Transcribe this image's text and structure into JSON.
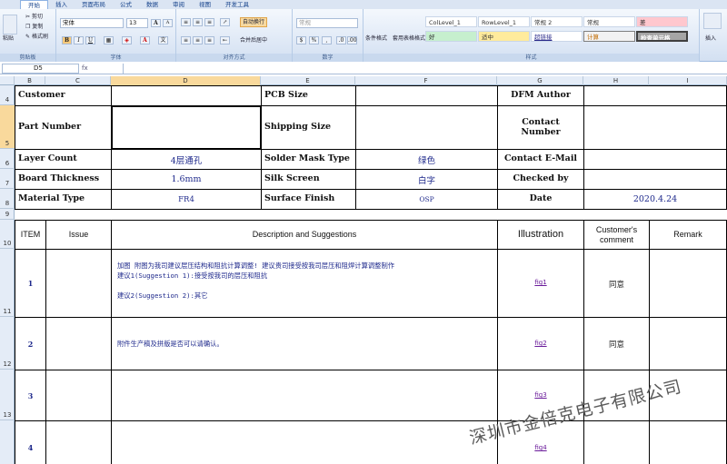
{
  "ribbon": {
    "tabs": [
      "开始",
      "插入",
      "页面布局",
      "公式",
      "数据",
      "审阅",
      "视图",
      "开发工具"
    ],
    "clipboard": {
      "paste": "粘贴",
      "cut": "剪切",
      "copy": "复制",
      "format_painter": "格式刷",
      "label": "剪贴板"
    },
    "font": {
      "name": "宋体",
      "size": "13",
      "bold": "B",
      "italic": "I",
      "underline": "U",
      "grow": "A",
      "shrink": "A",
      "label": "字体"
    },
    "alignment": {
      "wrap": "自动换行",
      "merge": "合并后居中",
      "label": "对齐方式"
    },
    "number": {
      "format": "常规",
      "percent": "%",
      "comma": ",",
      "label": "数字"
    },
    "styles": {
      "conditional": "条件格式",
      "table": "套用表格格式",
      "label": "样式",
      "cells": [
        "ColLevel_1",
        "RowLevel_1",
        "常规 2",
        "常规",
        "差",
        "好",
        "适中",
        "超链接",
        "计算",
        "检查单元格"
      ]
    },
    "insert_label": "插入",
    "colors": {
      "bad": "#ffc7ce",
      "good": "#c6efce",
      "neutral": "#ffeb9c",
      "check": "#a5a5a5",
      "calc": "#f2f2f2",
      "accent": "#1f2a8c",
      "link": "#6a1b9a"
    }
  },
  "formula_bar": {
    "cell_ref": "D5",
    "fx": "fx",
    "content": ""
  },
  "columns": [
    "B",
    "C",
    "D",
    "E",
    "F",
    "G",
    "H",
    "I"
  ],
  "selected_column": "D",
  "rows": [
    "4",
    "5",
    "6",
    "7",
    "8",
    "9",
    "10",
    "11",
    "12",
    "13",
    ""
  ],
  "selected_row": "5",
  "header_info": {
    "customer_label": "Customer",
    "customer_value": "",
    "pcb_size_label": "PCB Size",
    "pcb_size_value": "",
    "dfm_author_label": "DFM Author",
    "dfm_author_value": "",
    "part_number_label": "Part Number",
    "part_number_value": "",
    "shipping_size_label": "Shipping Size",
    "shipping_size_value": "",
    "contact_label": "Contact\nNumber",
    "contact_value": "",
    "layer_count_label": "Layer Count",
    "layer_count_value": "4层通孔",
    "solder_mask_label": "Solder Mask Type",
    "solder_mask_value": "绿色",
    "contact_email_label": "Contact E-Mail",
    "contact_email_value": "",
    "board_thickness_label": "Board Thickness",
    "board_thickness_value": "1.6mm",
    "silk_screen_label": "Silk Screen",
    "silk_screen_value": "白字",
    "checked_by_label": "Checked by",
    "checked_by_value": "",
    "material_label": "Material Type",
    "material_value": "FR4",
    "surface_finish_label": "Surface Finish",
    "surface_finish_value": "OSP",
    "date_label": "Date",
    "date_value": "2020.4.24"
  },
  "issue_table": {
    "headers": {
      "item": "ITEM",
      "issue": "Issue",
      "description": "Description and Suggestions",
      "illustration": "Illustration",
      "comment": "Customer's comment",
      "remark": "Remark"
    },
    "rows": [
      {
        "item": "1",
        "issue": "",
        "description": "加图 附图为我司建议层压结构和阻抗计算调整! 建议贵司接受按我司层压和阻焊计算调整制作\n建议1(Suggestion 1):接受按我司的层压和阻抗\n\n建议2(Suggestion 2):其它",
        "figure": "fig1",
        "comment": "同意",
        "remark": ""
      },
      {
        "item": "2",
        "issue": "",
        "description": "附件生产稿及拼版是否可以请确认。",
        "figure": "fig2",
        "comment": "同意",
        "remark": ""
      },
      {
        "item": "3",
        "issue": "",
        "description": "",
        "figure": "fig3",
        "comment": "",
        "remark": ""
      },
      {
        "item": "4",
        "issue": "",
        "description": "",
        "figure": "fig4",
        "comment": "",
        "remark": ""
      }
    ]
  },
  "watermark": "深圳市金倍克电子有限公司"
}
